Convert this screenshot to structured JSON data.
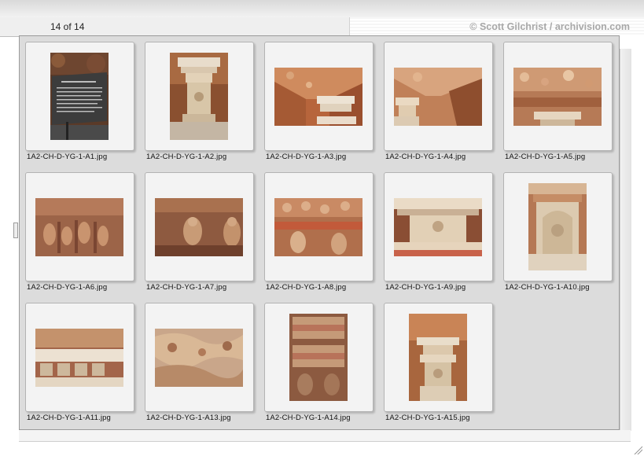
{
  "header": {
    "counter_text": "14 of 14",
    "credit_text": "© Scott Gilchrist / archivision.com"
  },
  "colors": {
    "panel_bg": "#dcdcdc",
    "card_bg": "#f3f3f3",
    "credit_text": "#a8a8a8"
  },
  "thumbnails": [
    {
      "filename": "1A2-CH-D-YG-1-A1.jpg",
      "subject": "information-sign"
    },
    {
      "filename": "1A2-CH-D-YG-1-A2.jpg",
      "subject": "pagoda-pillar"
    },
    {
      "filename": "1A2-CH-D-YG-1-A3.jpg",
      "subject": "carved-ceiling"
    },
    {
      "filename": "1A2-CH-D-YG-1-A4.jpg",
      "subject": "carved-ceiling"
    },
    {
      "filename": "1A2-CH-D-YG-1-A5.jpg",
      "subject": "carved-ceiling"
    },
    {
      "filename": "1A2-CH-D-YG-1-A6.jpg",
      "subject": "buddha-wall"
    },
    {
      "filename": "1A2-CH-D-YG-1-A7.jpg",
      "subject": "buddha-wall"
    },
    {
      "filename": "1A2-CH-D-YG-1-A8.jpg",
      "subject": "carved-ceiling"
    },
    {
      "filename": "1A2-CH-D-YG-1-A9.jpg",
      "subject": "pillar-capital"
    },
    {
      "filename": "1A2-CH-D-YG-1-A10.jpg",
      "subject": "pagoda-niche"
    },
    {
      "filename": "1A2-CH-D-YG-1-A11.jpg",
      "subject": "pillar-capital"
    },
    {
      "filename": "1A2-CH-D-YG-1-A13.jpg",
      "subject": "carved-ceiling"
    },
    {
      "filename": "1A2-CH-D-YG-1-A14.jpg",
      "subject": "carved-column"
    },
    {
      "filename": "1A2-CH-D-YG-1-A15.jpg",
      "subject": "pagoda-pillar"
    }
  ]
}
